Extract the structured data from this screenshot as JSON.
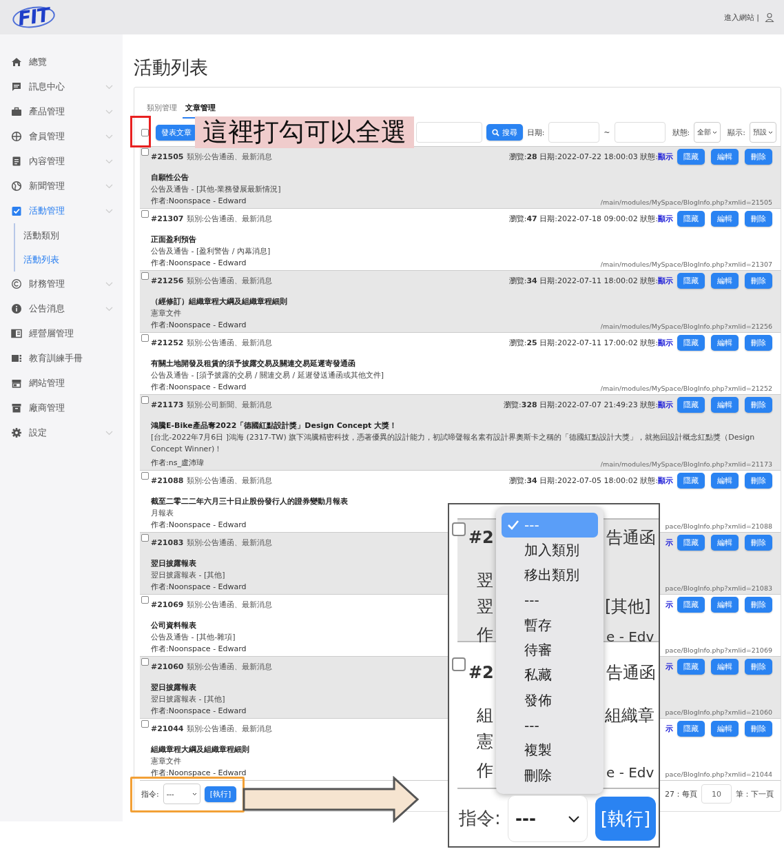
{
  "header": {
    "logo": "FIT",
    "site_link": "進入網站 |"
  },
  "sidebar": {
    "items": [
      {
        "label": "總覽",
        "expandable": false,
        "selected": false
      },
      {
        "label": "訊息中心",
        "expandable": true,
        "selected": false
      },
      {
        "label": "產品管理",
        "expandable": true,
        "selected": false
      },
      {
        "label": "會員管理",
        "expandable": true,
        "selected": false
      },
      {
        "label": "內容管理",
        "expandable": true,
        "selected": false
      },
      {
        "label": "新聞管理",
        "expandable": true,
        "selected": false
      },
      {
        "label": "活動管理",
        "expandable": true,
        "selected": true,
        "children": [
          {
            "label": "活動類別",
            "selected": false
          },
          {
            "label": "活動列表",
            "selected": true
          }
        ]
      },
      {
        "label": "財務管理",
        "expandable": true,
        "selected": false
      },
      {
        "label": "公告消息",
        "expandable": true,
        "selected": false
      },
      {
        "label": "經營層管理",
        "expandable": false,
        "selected": false
      },
      {
        "label": "教育訓練手冊",
        "expandable": false,
        "selected": false
      },
      {
        "label": "網站管理",
        "expandable": false,
        "selected": false
      },
      {
        "label": "廠商管理",
        "expandable": false,
        "selected": false
      },
      {
        "label": "設定",
        "expandable": true,
        "selected": false
      }
    ]
  },
  "page_title": "活動列表",
  "tabs": [
    {
      "label": "類別管理",
      "selected": false
    },
    {
      "label": "文章管理",
      "selected": true
    }
  ],
  "toolbar": {
    "select_all_checked": false,
    "publish_button": "發表文章",
    "search_button": "搜尋",
    "date_label": "日期:",
    "date_separator": "~",
    "status_label": "狀態:",
    "status_value": "全部",
    "display_label": "顯示:",
    "display_value": "預設"
  },
  "rows": [
    {
      "id": "#21505",
      "category": "類別:公告通函、最新消息",
      "stats": "瀏覽:**28** 日期:2022-07-22 18:00:03 狀態:",
      "status": "顯示",
      "title": "自願性公告",
      "subtitle": "公告及通告 - [其他-業務發展最新情況]",
      "author": "作者:Noonspace - Edward",
      "url": "/main/modules/MySpace/BlogInfo.php?xmlid=21505",
      "checked": false,
      "actions": [
        "隱藏",
        "編輯",
        "刪除"
      ]
    },
    {
      "id": "#21307",
      "category": "類別:公告通函、最新消息",
      "stats": "瀏覽:**47** 日期:2022-07-18 09:00:02 狀態:",
      "status": "顯示",
      "title": "正面盈利預告",
      "subtitle": "公告及通告 - [盈利警告 / 內幕消息]",
      "author": "作者:Noonspace - Edward",
      "url": "/main/modules/MySpace/BlogInfo.php?xmlid=21307",
      "checked": false,
      "actions": [
        "隱藏",
        "編輯",
        "刪除"
      ]
    },
    {
      "id": "#21256",
      "category": "類別:公告通函、最新消息",
      "stats": "瀏覽:**34** 日期:2022-07-11 18:00:02 狀態:",
      "status": "顯示",
      "title": "（經修訂）組織章程大綱及組織章程細則",
      "subtitle": "憲章文件",
      "author": "作者:Noonspace - Edward",
      "url": "/main/modules/MySpace/BlogInfo.php?xmlid=21256",
      "checked": false,
      "actions": [
        "隱藏",
        "編輯",
        "刪除"
      ]
    },
    {
      "id": "#21252",
      "category": "類別:公告通函、最新消息",
      "stats": "瀏覽:**25** 日期:2022-07-11 17:00:02 狀態:",
      "status": "顯示",
      "title": "有關土地開發及租賃的須予披露交易及關連交易延遲寄發通函",
      "subtitle": "公告及通告 - [須予披露的交易 / 關連交易 / 延遲發送通函或其他文件]",
      "author": "作者:Noonspace - Edward",
      "url": "/main/modules/MySpace/BlogInfo.php?xmlid=21252",
      "checked": false,
      "actions": [
        "隱藏",
        "編輯",
        "刪除"
      ]
    },
    {
      "id": "#21173",
      "category": "類別:公司新聞、最新消息",
      "stats": "瀏覽:**328** 日期:2022-07-07 21:49:23 狀態:",
      "status": "顯示",
      "title": "鴻騰E-Bike產品奪2022「德國紅點設計獎」Design Concept 大獎！",
      "subtitle": "[台北-2022年7月6日 ]鴻海 (2317-TW) 旗下鴻騰精密科技，憑著優異的設計能力，初試啼聲報名素有設計界奧斯卡之稱的「德國紅點設計大獎」，就抱回設計概念紅點獎（Design Concept Winner)！",
      "author": "作者:ns_盧沛瑋",
      "url": "/main/modules/MySpace/BlogInfo.php?xmlid=21173",
      "checked": false,
      "actions": [
        "隱藏",
        "編輯",
        "刪除"
      ]
    },
    {
      "id": "#21088",
      "category": "類別:公告通函、最新消息",
      "stats": "瀏覽:**34** 日期:2022-07-05 18:00:02 狀態:",
      "status": "顯示",
      "title": "截至二零二二年六月三十日止股份發行人的證券變動月報表",
      "subtitle": "月報表",
      "author": "作者:Noonspace - Edward",
      "url": "pace/BlogInfo.php?xmlid=21088",
      "checked": false,
      "actions": [
        "隱藏",
        "編輯",
        "刪除"
      ]
    },
    {
      "id": "#21083",
      "category": "類別:公告通函、最新消息",
      "status": "示",
      "title": "翌日披露報表",
      "subtitle": "翌日披露報表 - [其他]",
      "author": "作者:Noonspace - Edward",
      "url": "pace/BlogInfo.php?xmlid=21083",
      "checked": false,
      "actions": [
        "隱藏",
        "編輯",
        "刪除"
      ]
    },
    {
      "id": "#21069",
      "category": "類別:公告通函、最新消息",
      "status": "示",
      "title": "公司資料報表",
      "subtitle": "公告及通告 - [其他-雜項]",
      "author": "作者:Noonspace - Edward",
      "url": "pace/BlogInfo.php?xmlid=21069",
      "checked": false,
      "actions": [
        "隱藏",
        "編輯",
        "刪除"
      ]
    },
    {
      "id": "#21060",
      "category": "類別:公告通函、最新消息",
      "status": "示",
      "title": "翌日披露報表",
      "subtitle": "翌日披露報表 - [其他]",
      "author": "作者:Noonspace - Edward",
      "url": "pace/BlogInfo.php?xmlid=21060",
      "checked": false,
      "actions": [
        "隱藏",
        "編輯",
        "刪除"
      ]
    },
    {
      "id": "#21044",
      "category": "類別:公告通函、最新消息",
      "status": "示",
      "title": "組織章程大綱及組織章程細則",
      "subtitle": "憲章文件",
      "author": "作者:Noonspace - Edward",
      "url": "pace/BlogInfo.php?xmlid=21044",
      "checked": false,
      "actions": [
        "隱藏",
        "編輯",
        "刪除"
      ]
    }
  ],
  "footer": {
    "command_label": "指令:",
    "command_value": "---",
    "execute_button": "[執行]",
    "pager_lead": "27：每頁",
    "per_page": "10",
    "pager_tail": "筆：下一頁"
  },
  "annotations": {
    "select_all_note": "這裡打勾可以全選",
    "inset": {
      "checkboxes": [
        {
          "checked": false
        },
        {
          "checked": false
        }
      ],
      "fragments": [
        "#2",
        "告通函",
        "翌",
        "翌",
        "[其他]",
        "作",
        "e - Edv",
        "#2",
        "告通函",
        "組",
        "組織章",
        "憲",
        "作",
        "e - Edv"
      ],
      "menu": [
        {
          "label": "---",
          "selected": true
        },
        {
          "label": "加入類別",
          "selected": false
        },
        {
          "label": "移出類別",
          "selected": false
        },
        {
          "label": "---",
          "selected": false
        },
        {
          "label": "暫存",
          "selected": false
        },
        {
          "label": "待審",
          "selected": false
        },
        {
          "label": "私藏",
          "selected": false
        },
        {
          "label": "發佈",
          "selected": false
        },
        {
          "label": "---",
          "selected": false
        },
        {
          "label": "複製",
          "selected": false
        },
        {
          "label": "刪除",
          "selected": false
        }
      ],
      "command_label": "指令:",
      "command_value": "---",
      "execute_button": "[執行]"
    }
  }
}
